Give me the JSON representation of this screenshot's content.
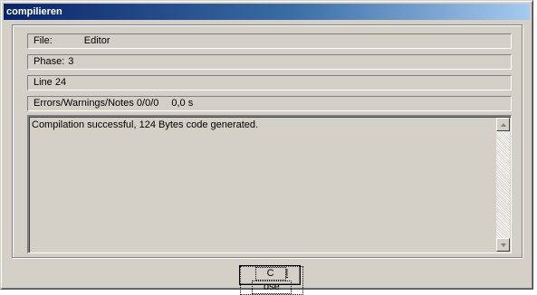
{
  "window": {
    "title": "compilieren"
  },
  "fields": {
    "file_label": "File:",
    "file_value": "Editor",
    "phase_label": "Phase:",
    "phase_value": "3",
    "line_text": "Line 24",
    "errors_label": "Errors/Warnings/Notes 0/0/0",
    "time_value": "0,0 s"
  },
  "output": {
    "message": "Compilation successful, 124 Bytes code generated."
  },
  "buttons": {
    "close_first": "C",
    "close_mnemonic": "l",
    "close_rest": "ose"
  }
}
